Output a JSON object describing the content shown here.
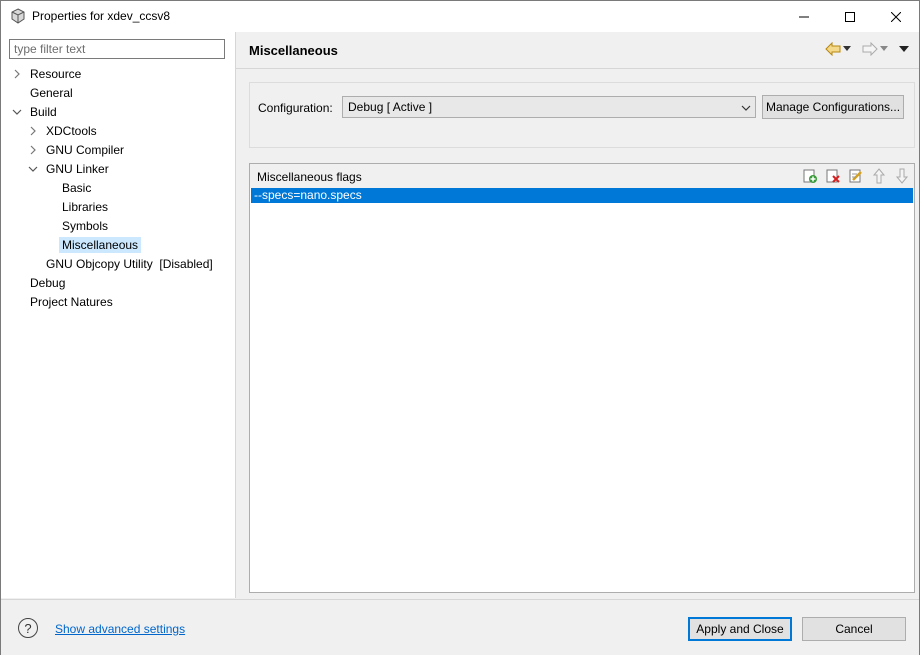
{
  "window": {
    "title": "Properties for xdev_ccsv8"
  },
  "filter": {
    "placeholder": "type filter text"
  },
  "tree": {
    "items": [
      {
        "label": "Resource",
        "expander": "collapsed"
      },
      {
        "label": "General",
        "expander": "none"
      },
      {
        "label": "Build",
        "expander": "expanded"
      },
      {
        "label": "XDCtools",
        "expander": "collapsed"
      },
      {
        "label": "GNU Compiler",
        "expander": "collapsed"
      },
      {
        "label": "GNU Linker",
        "expander": "expanded"
      },
      {
        "label": "Basic",
        "expander": "none"
      },
      {
        "label": "Libraries",
        "expander": "none"
      },
      {
        "label": "Symbols",
        "expander": "none"
      },
      {
        "label": "Miscellaneous",
        "expander": "none",
        "selected": true
      },
      {
        "label": "GNU Objcopy Utility  [Disabled]",
        "expander": "none"
      },
      {
        "label": "Debug",
        "expander": "none"
      },
      {
        "label": "Project Natures",
        "expander": "none"
      }
    ]
  },
  "page": {
    "title": "Miscellaneous"
  },
  "configuration": {
    "label": "Configuration:",
    "selected": "Debug  [ Active ]",
    "manage_label": "Manage Configurations..."
  },
  "flags": {
    "title": "Miscellaneous flags",
    "items": [
      "--specs=nano.specs"
    ]
  },
  "footer": {
    "advanced_link": "Show advanced settings",
    "apply_label": "Apply and Close",
    "cancel_label": "Cancel"
  },
  "colors": {
    "selection": "#0078d7",
    "tree_selection": "#cce8ff",
    "link": "#0066cc"
  }
}
